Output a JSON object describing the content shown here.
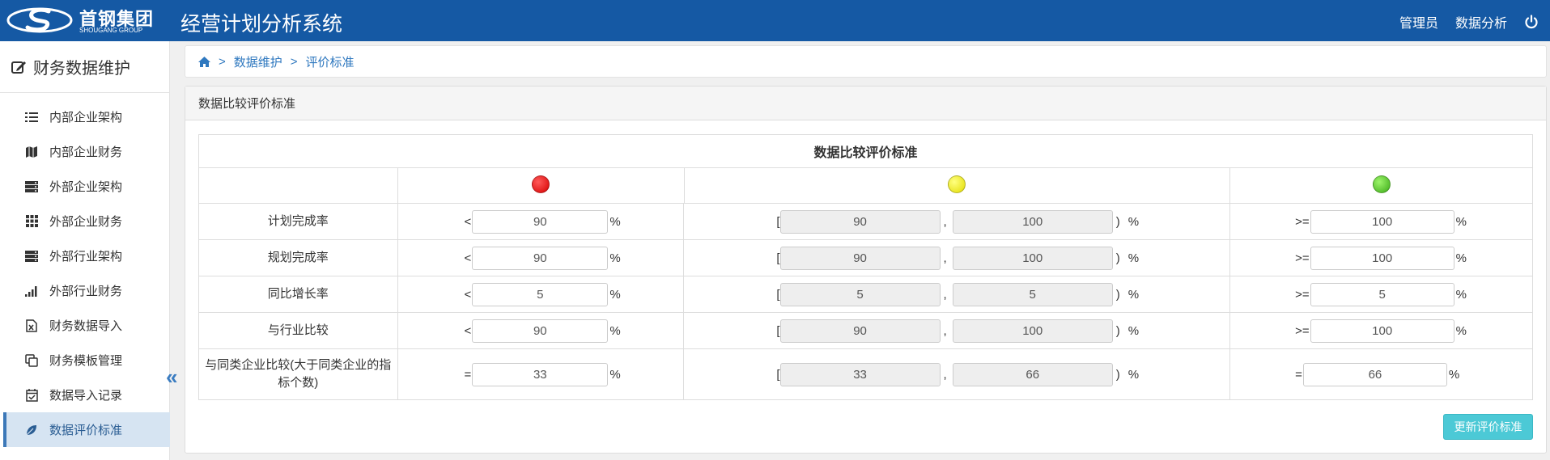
{
  "header": {
    "logo_cn": "首钢集团",
    "logo_en": "SHOUGANG GROUP",
    "title": "经营计划分析系统",
    "user": "管理员",
    "analysis_link": "数据分析",
    "power_icon": "power-icon",
    "bg_color": "#1559a4"
  },
  "sidebar": {
    "title": "财务数据维护",
    "items": [
      {
        "label": "内部企业架构",
        "icon": "list-icon"
      },
      {
        "label": "内部企业财务",
        "icon": "map-icon"
      },
      {
        "label": "外部企业架构",
        "icon": "server-icon"
      },
      {
        "label": "外部企业财务",
        "icon": "grid-icon"
      },
      {
        "label": "外部行业架构",
        "icon": "server-icon"
      },
      {
        "label": "外部行业财务",
        "icon": "signal-icon"
      },
      {
        "label": "财务数据导入",
        "icon": "excel-file-icon"
      },
      {
        "label": "财务模板管理",
        "icon": "copy-icon"
      },
      {
        "label": "数据导入记录",
        "icon": "calendar-check-icon"
      },
      {
        "label": "数据评价标准",
        "icon": "leaf-icon",
        "active": true
      }
    ],
    "active_color": "#d6e4f2"
  },
  "breadcrumb": {
    "home_icon": "home-icon",
    "sep": ">",
    "level1": "数据维护",
    "level2": "评价标准"
  },
  "panel": {
    "title": "数据比较评价标准",
    "table_title": "数据比较评价标准",
    "faces": [
      "sad-face-icon",
      "neutral-face-icon",
      "smile-face-icon"
    ],
    "rows": [
      {
        "label": "计划完成率",
        "op1": "<",
        "low": "90",
        "mid_from": "90",
        "mid_to": "100",
        "op3": ">=",
        "high": "100"
      },
      {
        "label": "规划完成率",
        "op1": "<",
        "low": "90",
        "mid_from": "90",
        "mid_to": "100",
        "op3": ">=",
        "high": "100"
      },
      {
        "label": "同比增长率",
        "op1": "<",
        "low": "5",
        "mid_from": "5",
        "mid_to": "5",
        "op3": ">=",
        "high": "5"
      },
      {
        "label": "与行业比较",
        "op1": "<",
        "low": "90",
        "mid_from": "90",
        "mid_to": "100",
        "op3": ">=",
        "high": "100"
      },
      {
        "label": "与同类企业比较(大于同类企业的指标个数)",
        "op1": "=",
        "low": "33",
        "mid_from": "33",
        "mid_to": "66",
        "op3": "=",
        "high": "66"
      }
    ],
    "pct": "%",
    "open_bracket": "[",
    "close_bracket": ")",
    "comma": ",",
    "update_button": "更新评价标准",
    "button_color": "#4cc9d6"
  }
}
